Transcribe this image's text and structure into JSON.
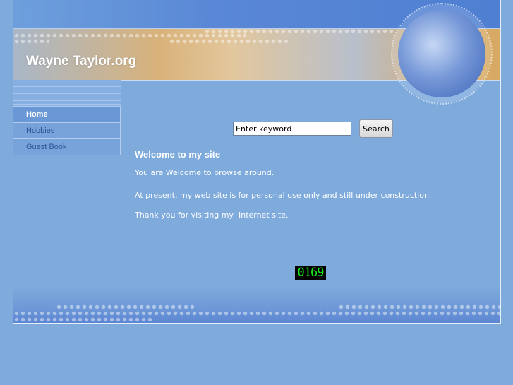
{
  "header": {
    "site_title": "Wayne Taylor.org"
  },
  "nav": {
    "items": [
      {
        "label": "Home",
        "active": true
      },
      {
        "label": "Hobbies"
      },
      {
        "label": "Guest Book"
      }
    ]
  },
  "search": {
    "value": "Enter keyword",
    "button_label": "Search"
  },
  "content": {
    "heading": "Welcome to my site",
    "paragraphs": [
      "You are Welcome to browse around.",
      "At present, my web site is for personal use only and still under construction.",
      "Thank you for visiting my  Internet site."
    ]
  },
  "counter": {
    "value": "0169"
  }
}
